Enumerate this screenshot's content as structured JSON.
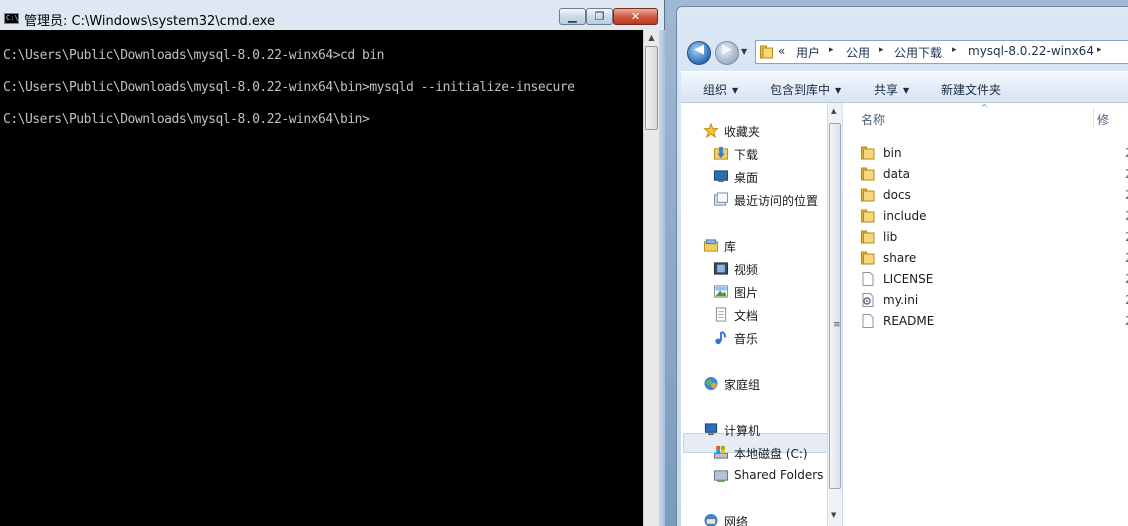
{
  "cmd": {
    "icon_text": "C:\\",
    "title": "管理员: C:\\Windows\\system32\\cmd.exe",
    "minimize": "▁",
    "maximize": "❐",
    "close": "✕",
    "lines": [
      "C:\\Users\\Public\\Downloads\\mysql-8.0.22-winx64>cd bin",
      "C:\\Users\\Public\\Downloads\\mysql-8.0.22-winx64\\bin>mysqld --initialize-insecure",
      "C:\\Users\\Public\\Downloads\\mysql-8.0.22-winx64\\bin>"
    ],
    "scroll_up_glyph": "▲"
  },
  "explorer": {
    "back_glyph": "◀",
    "forward_glyph": "▶",
    "history_dropdown": "▼",
    "breadcrumb": [
      "«",
      "用户",
      "公用",
      "公用下载",
      "mysql-8.0.22-winx64"
    ],
    "breadcrumb_sep": "▸",
    "toolbar": {
      "organize": "组织",
      "include_in_library": "包含到库中",
      "share": "共享",
      "new_folder": "新建文件夹",
      "dropdown_glyph": "▼"
    },
    "nav": [
      {
        "label": "收藏夹",
        "icon": "star-icon"
      },
      {
        "label": "下载",
        "icon": "downloads-folder-icon"
      },
      {
        "label": "桌面",
        "icon": "desktop-icon"
      },
      {
        "label": "最近访问的位置",
        "icon": "recent-places-icon"
      },
      {
        "label": "库",
        "icon": "libraries-icon"
      },
      {
        "label": "视频",
        "icon": "videos-icon"
      },
      {
        "label": "图片",
        "icon": "pictures-icon"
      },
      {
        "label": "文档",
        "icon": "documents-icon"
      },
      {
        "label": "音乐",
        "icon": "music-icon"
      },
      {
        "label": "家庭组",
        "icon": "homegroup-icon"
      },
      {
        "label": "计算机",
        "icon": "computer-icon"
      },
      {
        "label": "本地磁盘 (C:)",
        "icon": "local-disk-icon"
      },
      {
        "label": "Shared Folders",
        "icon": "shared-folders-icon"
      },
      {
        "label": "网络",
        "icon": "network-icon"
      }
    ],
    "scroll_up_glyph": "▲",
    "scroll_down_glyph": "▼",
    "grip_glyph": "≡",
    "columns": {
      "name": "名称",
      "date": "修",
      "sort_glyph": "^"
    },
    "files": [
      {
        "name": "bin",
        "type": "folder",
        "date": "2"
      },
      {
        "name": "data",
        "type": "folder",
        "date": "2"
      },
      {
        "name": "docs",
        "type": "folder",
        "date": "2"
      },
      {
        "name": "include",
        "type": "folder",
        "date": "2"
      },
      {
        "name": "lib",
        "type": "folder",
        "date": "2"
      },
      {
        "name": "share",
        "type": "folder",
        "date": "2"
      },
      {
        "name": "LICENSE",
        "type": "file",
        "date": "2"
      },
      {
        "name": "my.ini",
        "type": "config",
        "date": "2"
      },
      {
        "name": "README",
        "type": "file",
        "date": "2"
      }
    ]
  }
}
